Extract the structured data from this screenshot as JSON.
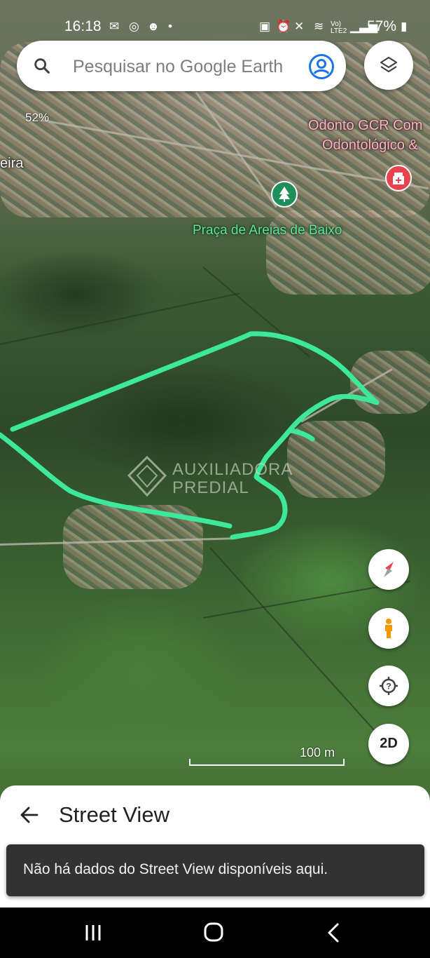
{
  "status_bar": {
    "time": "16:18",
    "battery": "57%",
    "signal_text": "Vo) LTE2"
  },
  "search": {
    "placeholder": "Pesquisar no Google Earth"
  },
  "map_labels": {
    "poi_dental_line1": "Odonto GCR Com",
    "poi_dental_line2": "Odontológico &",
    "park": "Praça de Areias de Baixo",
    "left_partial": "eira",
    "percent": "52%"
  },
  "watermark": {
    "line1": "AUXILIADORA",
    "line2": "PREDIAL"
  },
  "scale": {
    "label": "100 m"
  },
  "controls": {
    "mode_button": "2D"
  },
  "bottom_sheet": {
    "title": "Street View",
    "snackbar": "Não há dados do Street View disponíveis aqui."
  },
  "colors": {
    "outline": "#3ee89a",
    "park_pin": "#1e8e5a",
    "medical_pin": "#e8424f",
    "account_blue": "#1a73e8"
  },
  "icons": [
    "search-icon",
    "account-icon",
    "layers-icon",
    "compass-icon",
    "pegman-icon",
    "location-icon",
    "back-arrow-icon",
    "recents-icon",
    "home-icon",
    "back-icon"
  ]
}
